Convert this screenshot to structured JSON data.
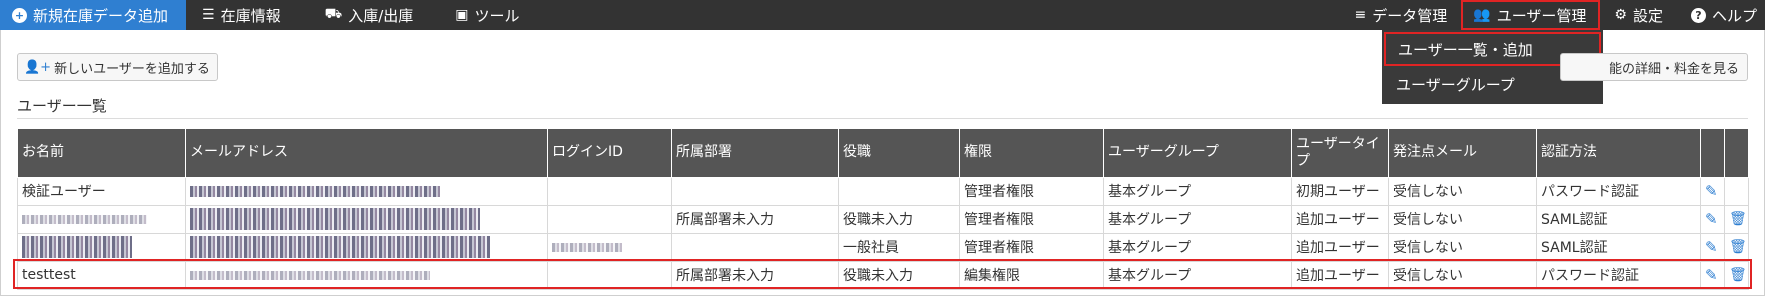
{
  "navbar": {
    "new_stock_label": "新規在庫データ追加",
    "stock_info_label": "在庫情報",
    "in_out_label": "入庫/出庫",
    "tools_label": "ツール",
    "data_mgmt_label": "データ管理",
    "user_mgmt_label": "ユーザー管理",
    "settings_label": "設定",
    "help_label": "ヘルプ"
  },
  "dropdown": {
    "items": [
      "ユーザー一覧・追加",
      "ユーザーグループ"
    ]
  },
  "toolbar": {
    "add_user_label": "新しいユーザーを追加する",
    "details_label": "能の詳細・料金を見る"
  },
  "section_title": "ユーザー一覧",
  "table": {
    "headers": [
      "お名前",
      "メールアドレス",
      "ログインID",
      "所属部署",
      "役職",
      "権限",
      "ユーザーグループ",
      "ユーザータイプ",
      "発注点メール",
      "認証方法"
    ],
    "rows": [
      {
        "name": "検証ユーザー",
        "department": "",
        "position": "",
        "permission": "管理者権限",
        "group": "基本グループ",
        "type": "初期ユーザー",
        "mail": "受信しない",
        "auth": "パスワード認証"
      },
      {
        "name": "",
        "department": "所属部署未入力",
        "position": "役職未入力",
        "permission": "管理者権限",
        "group": "基本グループ",
        "type": "追加ユーザー",
        "mail": "受信しない",
        "auth": "SAML認証"
      },
      {
        "name": "",
        "department": "",
        "position": "一般社員",
        "permission": "管理者権限",
        "group": "基本グループ",
        "type": "追加ユーザー",
        "mail": "受信しない",
        "auth": "SAML認証"
      },
      {
        "name": "testtest",
        "department": "所属部署未入力",
        "position": "役職未入力",
        "permission": "編集権限",
        "group": "基本グループ",
        "type": "追加ユーザー",
        "mail": "受信しない",
        "auth": "パスワード認証"
      }
    ]
  },
  "icons": {
    "edit": "pencil-icon",
    "delete": "trash-icon",
    "users": "users-icon",
    "gear": "gear-icon",
    "help": "question-circle-icon"
  },
  "colors": {
    "navbar_bg": "#333333",
    "active_tab": "#2f7fd1",
    "highlight": "#e02424",
    "icon_blue": "#2f7fd1"
  }
}
